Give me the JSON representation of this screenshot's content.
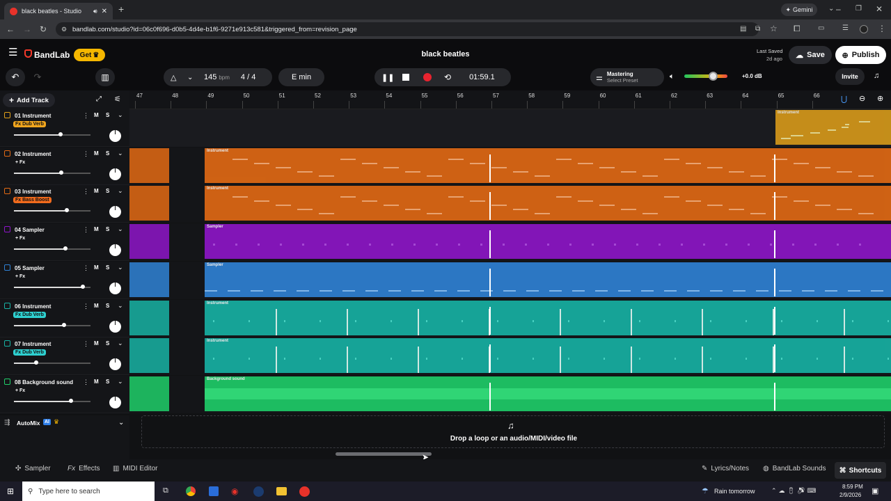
{
  "browser": {
    "tab_title": "black beatles - Studio",
    "url": "bandlab.com/studio?id=06c0f696-d0b5-4d4e-b1f6-9271e913c581&triggered_from=revision_page",
    "gemini": "Gemini"
  },
  "header": {
    "brand": "BandLab",
    "get_label": "Get",
    "project_title": "black beatles",
    "last_saved_label": "Last Saved",
    "last_saved_value": "2d ago",
    "save_label": "Save",
    "publish_label": "Publish"
  },
  "transport": {
    "bpm": "145",
    "bpm_unit": "bpm",
    "time_signature": "4 / 4",
    "key": "E min",
    "time": "01:59.1",
    "mastering_title": "Mastering",
    "mastering_preset": "Select Preset",
    "volume_db": "+0.0 dB",
    "invite_label": "Invite"
  },
  "toolbar": {
    "add_track": "Add Track"
  },
  "ruler": {
    "bars": [
      "47",
      "48",
      "49",
      "50",
      "51",
      "52",
      "53",
      "54",
      "55",
      "56",
      "57",
      "58",
      "59",
      "60",
      "61",
      "62",
      "63",
      "64",
      "65",
      "66"
    ]
  },
  "tracks": [
    {
      "name": "01  Instrument",
      "fx": "Fx Dub Verb",
      "fx_color": "#f0a51e",
      "color": "#e3a21a",
      "volume": 0.68
    },
    {
      "name": "02  Instrument",
      "fx": "+ Fx",
      "fx_color": "",
      "color": "#e36a14",
      "volume": 0.69
    },
    {
      "name": "03  Instrument",
      "fx": "Fx Bass Boost",
      "fx_color": "#f26b1d",
      "color": "#e36a14",
      "volume": 0.77
    },
    {
      "name": "04  Sampler",
      "fx": "+ Fx",
      "fx_color": "",
      "color": "#8e15c9",
      "volume": 0.75
    },
    {
      "name": "05  Sampler",
      "fx": "+ Fx",
      "fx_color": "",
      "color": "#2f82d6",
      "volume": 1.0
    },
    {
      "name": "06  Instrument",
      "fx": "Fx Dub Verb",
      "fx_color": "#2ed0d0",
      "color": "#17b3a5",
      "volume": 0.73
    },
    {
      "name": "07  Instrument",
      "fx": "Fx Dub Verb",
      "fx_color": "#2ed0d0",
      "color": "#17b3a5",
      "volume": 0.32
    },
    {
      "name": "08  Background sound",
      "fx": "+ Fx",
      "fx_color": "",
      "color": "#1fcf6a",
      "volume": 0.83
    }
  ],
  "ms": {
    "m": "M",
    "s": "S"
  },
  "clip_labels": [
    "Instrument",
    "Instrument",
    "Instrument",
    "Sampler",
    "Sampler",
    "Instrument",
    "Instrument",
    "Background sound"
  ],
  "automix": {
    "label": "AutoMix",
    "badge": "AI"
  },
  "dropzone": {
    "text": "Drop a loop or an audio/MIDI/video file"
  },
  "bottom": {
    "sampler": "Sampler",
    "effects": "Effects",
    "midi": "MIDI Editor",
    "lyrics": "Lyrics/Notes",
    "sounds": "BandLab Sounds",
    "shortcuts": "Shortcuts"
  },
  "taskbar": {
    "search": "Type here to search",
    "weather": "Rain tomorrow",
    "time": "8:59 PM",
    "date": "2/9/2026"
  }
}
